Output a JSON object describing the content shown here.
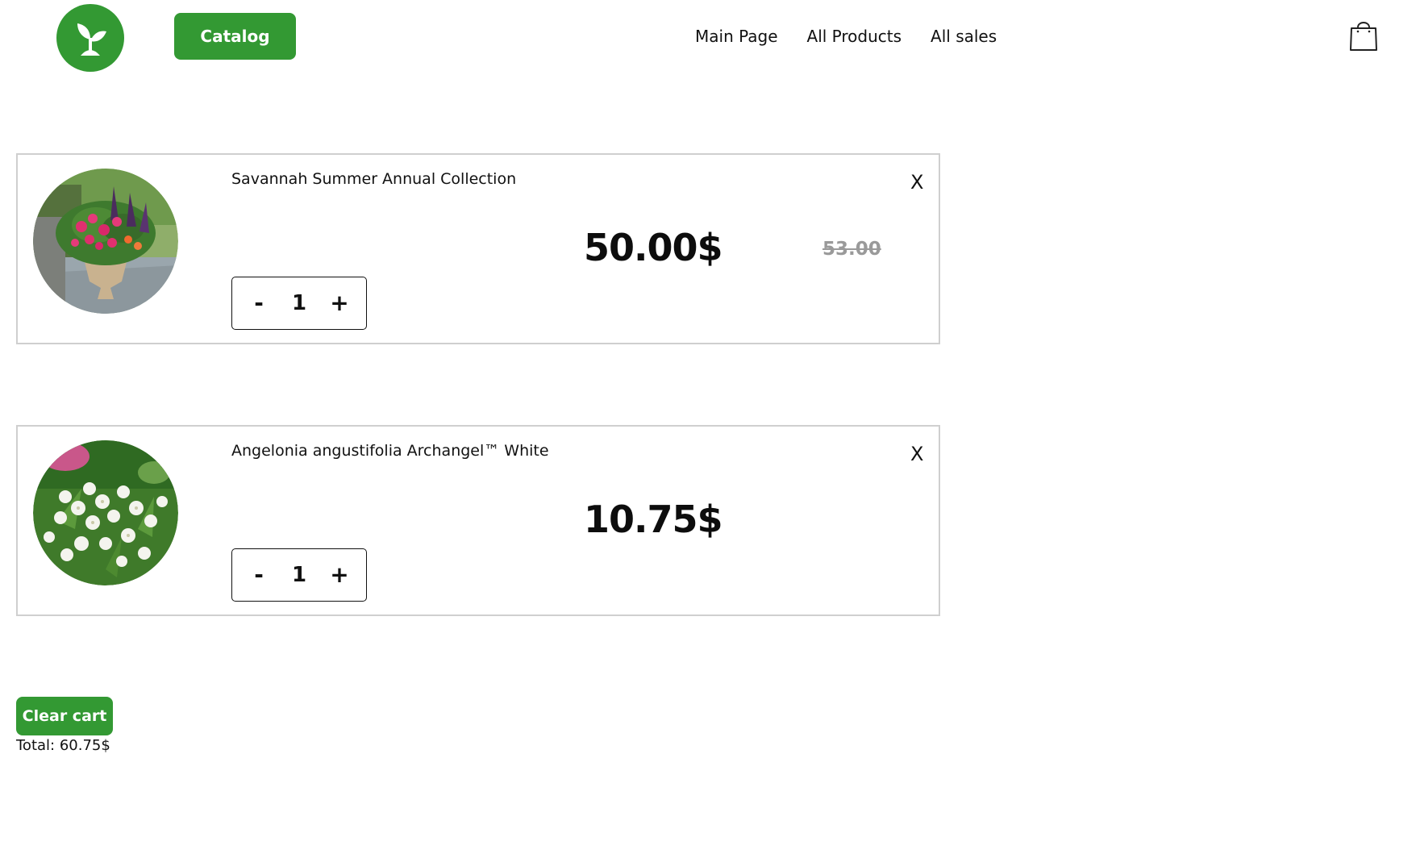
{
  "header": {
    "logo_icon": "sprout-icon",
    "catalog_label": "Catalog",
    "nav": {
      "main_page": "Main Page",
      "all_products": "All Products",
      "all_sales": "All sales"
    },
    "cart_icon": "shopping-bag-icon"
  },
  "cart": {
    "items": [
      {
        "title": "Savannah Summer Annual Collection",
        "quantity": "1",
        "decrement_label": "-",
        "increment_label": "+",
        "price": "50.00$",
        "old_price": "53.00",
        "remove_label": "X",
        "image": "flower-urn-photo"
      },
      {
        "title": "Angelonia angustifolia Archangel™ White",
        "quantity": "1",
        "decrement_label": "-",
        "increment_label": "+",
        "price": "10.75$",
        "remove_label": "X",
        "image": "white-flowers-photo"
      }
    ],
    "clear_label": "Clear cart",
    "total_text": "Total: 60.75$"
  },
  "colors": {
    "brand_green": "#339933",
    "border_gray": "#cfcfcf",
    "old_price_gray": "#9a9a9a"
  }
}
